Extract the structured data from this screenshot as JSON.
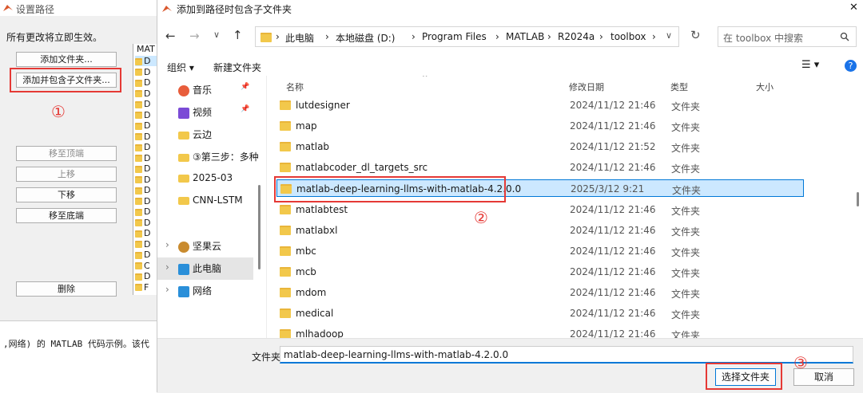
{
  "bg_window": {
    "title": "设置路径",
    "note": "所有更改将立即生效。",
    "add_folder": "添加文件夹...",
    "add_with_subfolders": "添加并包含子文件夹...",
    "move_top": "移至顶端",
    "move_up": "上移",
    "move_down": "下移",
    "move_bottom": "移至底端",
    "delete": "删除",
    "list_header": "MAT",
    "list_items": [
      "D",
      "D",
      "D",
      "D",
      "D",
      "D",
      "D",
      "D",
      "D",
      "D",
      "D",
      "D",
      "D",
      "D",
      "D",
      "D",
      "D",
      "D",
      "D",
      "C",
      "D",
      "F"
    ],
    "bottom_text": ",网络) 的 MATLAB 代码示例。该代",
    "marker_1": "①"
  },
  "dialog": {
    "title": "添加到路径时包含子文件夹",
    "close": "✕",
    "breadcrumbs": [
      "此电脑",
      "本地磁盘 (D:)",
      "Program Files",
      "MATLAB",
      "R2024a",
      "toolbox"
    ],
    "search_placeholder": "在 toolbox 中搜索",
    "organize": "组织 ▾",
    "new_folder": "新建文件夹",
    "sidebar": [
      {
        "label": "音乐",
        "icon": "music-icon",
        "pin": "📌"
      },
      {
        "label": "视频",
        "icon": "video-icon",
        "pin": "📌"
      },
      {
        "label": "云边",
        "icon": "folder-icon"
      },
      {
        "label": "③第三步：多种",
        "icon": "folder-icon"
      },
      {
        "label": "2025-03",
        "icon": "folder-icon"
      },
      {
        "label": "CNN-LSTM",
        "icon": "folder-icon"
      },
      {
        "label": "坚果云",
        "icon": "nut-icon"
      },
      {
        "label": "此电脑",
        "icon": "pc-icon"
      },
      {
        "label": "网络",
        "icon": "network-icon"
      }
    ],
    "columns": {
      "name": "名称",
      "date": "修改日期",
      "type": "类型",
      "size": "大小"
    },
    "files": [
      {
        "name": "lutdesigner",
        "date": "2024/11/12 21:46",
        "type": "文件夹"
      },
      {
        "name": "map",
        "date": "2024/11/12 21:46",
        "type": "文件夹"
      },
      {
        "name": "matlab",
        "date": "2024/11/12 21:52",
        "type": "文件夹"
      },
      {
        "name": "matlabcoder_dl_targets_src",
        "date": "2024/11/12 21:46",
        "type": "文件夹"
      },
      {
        "name": "matlab-deep-learning-llms-with-matlab-4.2.0.0",
        "date": "2025/3/12 9:21",
        "type": "文件夹"
      },
      {
        "name": "matlabtest",
        "date": "2024/11/12 21:46",
        "type": "文件夹"
      },
      {
        "name": "matlabxl",
        "date": "2024/11/12 21:46",
        "type": "文件夹"
      },
      {
        "name": "mbc",
        "date": "2024/11/12 21:46",
        "type": "文件夹"
      },
      {
        "name": "mcb",
        "date": "2024/11/12 21:46",
        "type": "文件夹"
      },
      {
        "name": "mdom",
        "date": "2024/11/12 21:46",
        "type": "文件夹"
      },
      {
        "name": "medical",
        "date": "2024/11/12 21:46",
        "type": "文件夹"
      },
      {
        "name": "mlhadoop",
        "date": "2024/11/12 21:46",
        "type": "文件夹"
      }
    ],
    "folder_label": "文件夹:",
    "folder_value": "matlab-deep-learning-llms-with-matlab-4.2.0.0",
    "select_button": "选择文件夹",
    "cancel_button": "取消",
    "marker_2": "②",
    "marker_3": "③"
  },
  "colors": {
    "accent": "#e53935",
    "selection": "#cce8ff",
    "selection_border": "#0078d7",
    "folder": "#f2c84b"
  }
}
